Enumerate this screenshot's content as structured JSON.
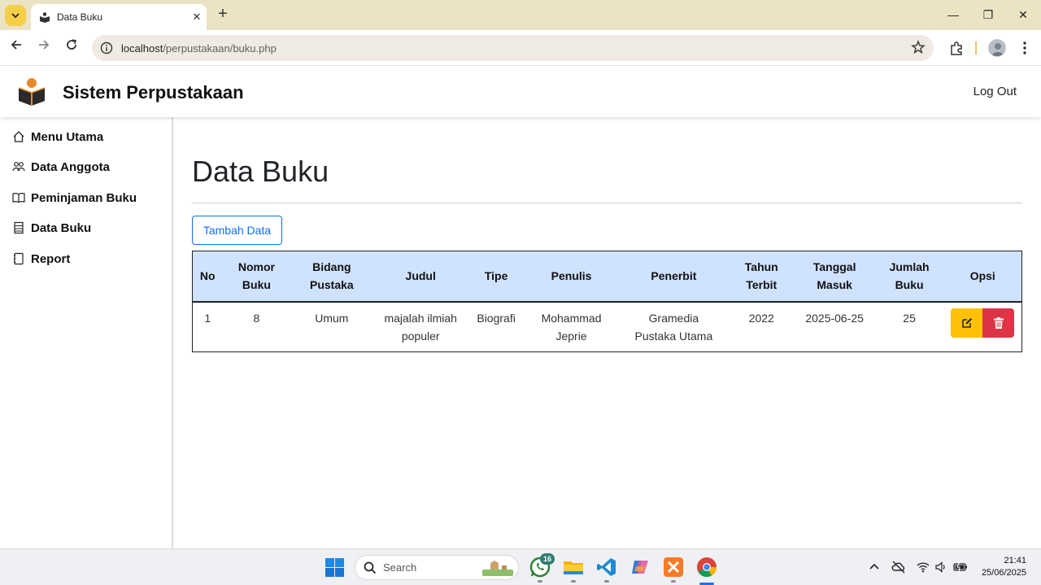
{
  "browser": {
    "tab_title": "Data Buku",
    "url_host": "localhost",
    "url_path": "/perpustakaan/buku.php"
  },
  "header": {
    "brand": "Sistem Perpustakaan",
    "logout": "Log Out"
  },
  "sidebar": {
    "items": [
      {
        "label": "Menu Utama",
        "icon": "home-icon"
      },
      {
        "label": "Data Anggota",
        "icon": "people-icon"
      },
      {
        "label": "Peminjaman Buku",
        "icon": "book-open-icon"
      },
      {
        "label": "Data Buku",
        "icon": "list-icon"
      },
      {
        "label": "Report",
        "icon": "journal-icon"
      }
    ]
  },
  "main": {
    "title": "Data Buku",
    "add_button": "Tambah Data",
    "table": {
      "headers": [
        [
          "No"
        ],
        [
          "Nomor",
          "Buku"
        ],
        [
          "Bidang",
          "Pustaka"
        ],
        [
          "Judul"
        ],
        [
          "Tipe"
        ],
        [
          "Penulis"
        ],
        [
          "Penerbit"
        ],
        [
          "Tahun",
          "Terbit"
        ],
        [
          "Tanggal",
          "Masuk"
        ],
        [
          "Jumlah",
          "Buku"
        ],
        [
          "Opsi"
        ]
      ],
      "rows": [
        {
          "no": "1",
          "nomor_buku": "8",
          "bidang_pustaka": "Umum",
          "judul": [
            "majalah ilmiah",
            "populer"
          ],
          "tipe": "Biografi",
          "penulis": [
            "Mohammad",
            "Jeprie"
          ],
          "penerbit": [
            "Gramedia",
            "Pustaka Utama"
          ],
          "tahun_terbit": "2022",
          "tanggal_masuk": "2025-06-25",
          "jumlah_buku": "25"
        }
      ]
    }
  },
  "taskbar": {
    "search_placeholder": "Search",
    "whatsapp_badge": "16",
    "time": "21:41",
    "date": "25/06/2025"
  },
  "colors": {
    "primary": "#0d6efd",
    "warning": "#ffc107",
    "danger": "#dc3545",
    "table_header": "#cfe2ff",
    "browser_frame": "#ebe4c4"
  }
}
